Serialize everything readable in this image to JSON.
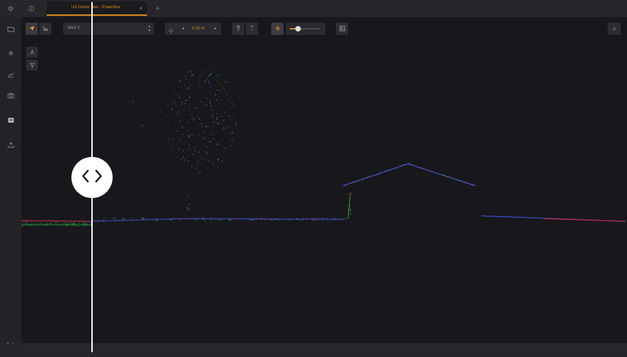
{
  "tabbar": {
    "left_icons": [
      "gear-icon",
      "info-icon"
    ],
    "tab_title": "US Demo Tour - Powerline",
    "close_label": "×",
    "add_label": "+"
  },
  "sidebar": {
    "icons": [
      "folder-icon",
      "filter-icon",
      "layers-icon",
      "camera-icon",
      "save-icon",
      "export-icon"
    ],
    "logo_c": "C",
    "logo_s": "S"
  },
  "toolbar": {
    "slice_select_value": "Slice 2",
    "slice_select_arrow": "⌃⌄",
    "thickness_value": "0.20 m",
    "thickness_dec": "◂",
    "thickness_inc": "▸",
    "point_size_slider": 0.28,
    "close_label": "×"
  },
  "colors": {
    "accent": "#d98b1e",
    "background": "#18181c",
    "panel": "#26262b"
  }
}
